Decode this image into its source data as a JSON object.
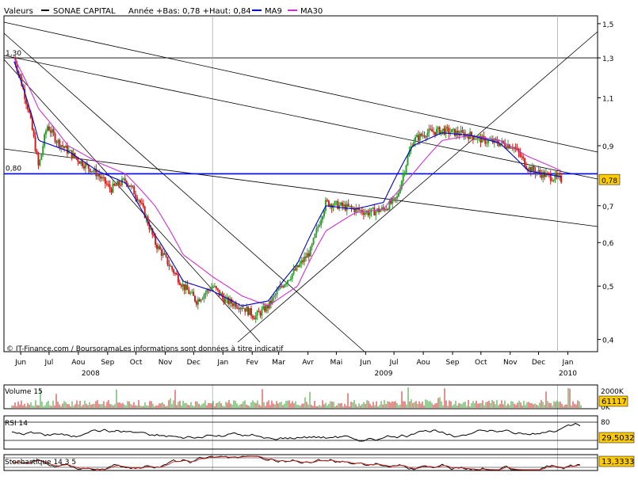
{
  "legend": {
    "values_label": "Valeurs",
    "instrument": "SONAE CAPITAL",
    "range_text": "Année +Bas: 0,78 +Haut: 0,84",
    "ma9": "MA9",
    "ma30": "MA30"
  },
  "colors": {
    "price_up": "#2e9e2e",
    "price_down": "#cc1f1f",
    "ma9": "#0000cc",
    "ma30": "#cc33cc",
    "support_line": "#0000ff",
    "volume_bar": "#2e9e2e",
    "tag_bg": "#ffcc00"
  },
  "source": "© IT-Finance.com / BoursoramaLes informations sont données à titre indicatif",
  "chart_data": [
    {
      "type": "line",
      "title": "SONAE CAPITAL",
      "xlabel": "",
      "ylabel": "",
      "y_scale": "log",
      "ylim": [
        0.38,
        1.55
      ],
      "x_range": [
        "2008-06",
        "2010-01"
      ],
      "y_ticks": [
        "1,5",
        "1,3",
        "1,1",
        "0,9",
        "0,7",
        "0,6",
        "0,5",
        "0,4"
      ],
      "y_tick_values": [
        1.5,
        1.3,
        1.1,
        0.9,
        0.7,
        0.6,
        0.5,
        0.4
      ],
      "x_ticks": [
        "Jun",
        "Jul",
        "Aou",
        "Sep",
        "Oct",
        "Nov",
        "Dec",
        "Jan",
        "Fev",
        "Mar",
        "Avr",
        "Mai",
        "Jun",
        "Jul",
        "Aou",
        "Sep",
        "Oct",
        "Nov",
        "Dec",
        "Jan"
      ],
      "years": [
        "2008",
        "2009",
        "2010"
      ],
      "price_labels": {
        "high": "1,30",
        "low": "0,80",
        "last": "0,78"
      },
      "price_label_values": {
        "high": 1.3,
        "low": 0.8,
        "last": 0.78
      },
      "support_level": 0.8,
      "series": [
        {
          "name": "SONAE CAPITAL",
          "kind": "price",
          "x": [
            "2008-06-05",
            "2008-06-20",
            "2008-07-01",
            "2008-07-10",
            "2008-07-20",
            "2008-08-01",
            "2008-08-15",
            "2008-09-01",
            "2008-09-15",
            "2008-10-01",
            "2008-10-15",
            "2008-11-01",
            "2008-11-15",
            "2008-12-01",
            "2008-12-15",
            "2009-01-01",
            "2009-01-15",
            "2009-02-01",
            "2009-02-15",
            "2009-03-01",
            "2009-03-15",
            "2009-04-01",
            "2009-04-15",
            "2009-05-01",
            "2009-05-15",
            "2009-06-01",
            "2009-06-15",
            "2009-07-01",
            "2009-07-15",
            "2009-08-01",
            "2009-08-15",
            "2009-09-01",
            "2009-09-15",
            "2009-10-01",
            "2009-10-15",
            "2009-11-01",
            "2009-11-15",
            "2009-12-01",
            "2009-12-15",
            "2010-01-05"
          ],
          "values": [
            1.3,
            1.05,
            0.82,
            0.98,
            0.92,
            0.88,
            0.84,
            0.8,
            0.75,
            0.78,
            0.72,
            0.6,
            0.55,
            0.5,
            0.47,
            0.5,
            0.47,
            0.46,
            0.44,
            0.46,
            0.5,
            0.54,
            0.58,
            0.71,
            0.7,
            0.69,
            0.68,
            0.69,
            0.72,
            0.92,
            0.95,
            0.96,
            0.95,
            0.94,
            0.92,
            0.91,
            0.9,
            0.82,
            0.8,
            0.78
          ]
        },
        {
          "name": "MA9",
          "kind": "ma",
          "x": [
            "2008-06-05",
            "2008-07-01",
            "2008-08-01",
            "2008-09-01",
            "2008-10-01",
            "2008-11-01",
            "2008-12-01",
            "2009-01-01",
            "2009-02-01",
            "2009-03-01",
            "2009-04-01",
            "2009-05-01",
            "2009-06-01",
            "2009-07-01",
            "2009-08-01",
            "2009-09-01",
            "2009-10-01",
            "2009-11-01",
            "2009-12-01",
            "2010-01-05"
          ],
          "values": [
            1.28,
            0.92,
            0.88,
            0.81,
            0.77,
            0.62,
            0.51,
            0.49,
            0.46,
            0.47,
            0.55,
            0.7,
            0.69,
            0.71,
            0.9,
            0.95,
            0.94,
            0.91,
            0.81,
            0.79
          ]
        },
        {
          "name": "MA30",
          "kind": "ma",
          "x": [
            "2008-06-05",
            "2008-07-01",
            "2008-08-01",
            "2008-09-01",
            "2008-10-01",
            "2008-11-01",
            "2008-12-01",
            "2009-01-01",
            "2009-02-01",
            "2009-03-01",
            "2009-04-01",
            "2009-05-01",
            "2009-06-01",
            "2009-07-01",
            "2009-08-01",
            "2009-09-01",
            "2009-10-01",
            "2009-11-01",
            "2009-12-01",
            "2010-01-05"
          ],
          "values": [
            1.3,
            1.05,
            0.9,
            0.84,
            0.8,
            0.7,
            0.57,
            0.52,
            0.48,
            0.46,
            0.5,
            0.63,
            0.68,
            0.69,
            0.8,
            0.92,
            0.94,
            0.92,
            0.86,
            0.81
          ]
        }
      ]
    },
    {
      "type": "bar",
      "title": "Volume 15",
      "y_ticks": [
        "2000K",
        "0K"
      ],
      "last_value": "61117"
    },
    {
      "type": "line",
      "title": "RSI 14",
      "y_ticks": [
        "80"
      ],
      "last_value": "29,5032"
    },
    {
      "type": "line",
      "title": "Stochastique 14 3 5",
      "y_ticks": [],
      "last_value": "13,3333"
    }
  ]
}
